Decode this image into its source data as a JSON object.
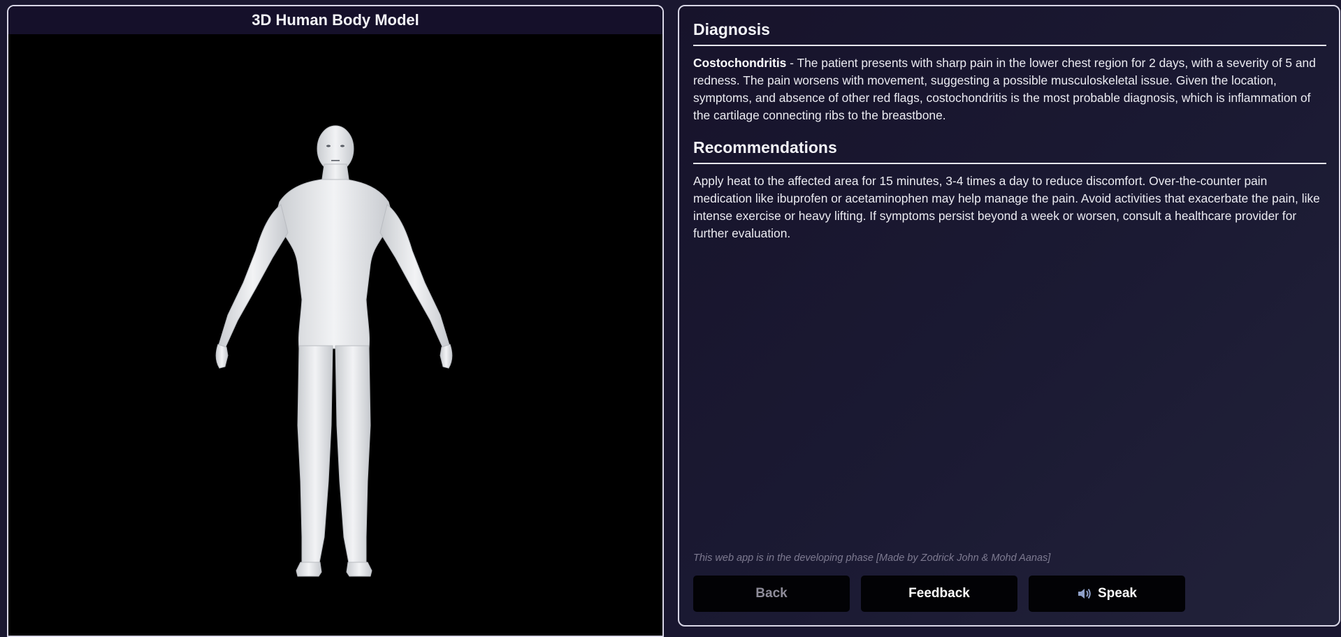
{
  "viewer": {
    "title": "3D Human Body Model"
  },
  "diagnosis": {
    "heading": "Diagnosis",
    "condition": "Costochondritis",
    "text": " - The patient presents with sharp pain in the lower chest region for 2 days, with a severity of 5 and redness. The pain worsens with movement, suggesting a possible musculoskeletal issue. Given the location, symptoms, and absence of other red flags, costochondritis is the most probable diagnosis, which is inflammation of the cartilage connecting ribs to the breastbone."
  },
  "recommendations": {
    "heading": "Recommendations",
    "text": "Apply heat to the affected area for 15 minutes, 3-4 times a day to reduce discomfort. Over-the-counter pain medication like ibuprofen or acetaminophen may help manage the pain. Avoid activities that exacerbate the pain, like intense exercise or heavy lifting. If symptoms persist beyond a week or worsen, consult a healthcare provider for further evaluation."
  },
  "footer": {
    "note": "This web app is in the developing phase [Made by Zodrick John & Mohd Aanas]"
  },
  "buttons": {
    "back": "Back",
    "feedback": "Feedback",
    "speak": "Speak",
    "speak_icon": "speaker-icon"
  },
  "colors": {
    "panel_border": "#d8d6e6",
    "viewer_header": "#15102a",
    "body_model": "#eceef0",
    "button_bg": "#020205"
  }
}
